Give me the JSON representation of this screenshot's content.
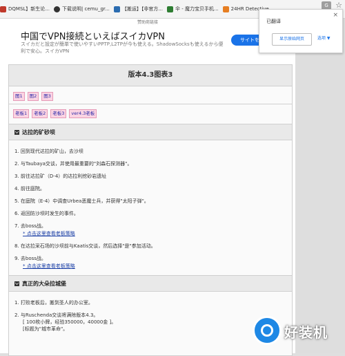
{
  "bookmarks": [
    {
      "label": "DQMSL】新生论...",
      "color": "#c0392b"
    },
    {
      "label": "下载说明| cemu_gr...",
      "color": "#333333"
    },
    {
      "label": "【搬运】【非官方...",
      "color": "#2b6cb0"
    },
    {
      "label": "伞 - 魔力宝贝手机...",
      "color": "#2e7d32"
    },
    {
      "label": "24HR Detective",
      "color": "#e67e22"
    }
  ],
  "translate_popup": {
    "title": "已翻译",
    "show_original": "显示原始网页",
    "options": "选项 ▼",
    "close": "×"
  },
  "ad": {
    "small_label": "赞助商链接",
    "title": "中国でVPN接続といえばスイカVPN",
    "desc": "スイカだと設定が簡単で使いやすいPPTP,L2TPが今も使える。ShadowSocksも使えるから便利で安心。スイカVPN",
    "button": "サイトを見る"
  },
  "article": {
    "title": "版本4.3图表3",
    "tags_row1": [
      "图1",
      "图2",
      "图3"
    ],
    "tags_row2": [
      "老板1",
      "老板2",
      "老板3",
      "ver4.3老板"
    ],
    "sections": [
      {
        "heading": "达拉的矿砂坝",
        "steps": [
          {
            "text": "1. 回到现代达拉的矿山，去沙坝"
          },
          {
            "text": "2. 与Taubaya交谈，并使用最重要的\"刘森石探测器\"。"
          },
          {
            "text": "3. 前往达拉矿（D-4）的达拉利挖砂岩遗址"
          },
          {
            "text": "4. 前往庭院。"
          },
          {
            "text": "5. 在庭院（E-4）中调查Urbea恶魔士兵，并获得\"太阳子弹\"。"
          },
          {
            "text": "6. 返回防沙坝时发生的事件。"
          },
          {
            "text": "7. 去boss战。",
            "sub": "* 点击这里查看老板策略"
          },
          {
            "text": "8. 在达拉采石场的沙坝前与Kaatis交谈，然后选择\"是\"参加活动。"
          },
          {
            "text": "9. 去boss战。",
            "sub": "* 点击这里查看老板策略"
          }
        ]
      },
      {
        "heading": "真正的大朵拉城堡",
        "steps": [
          {
            "text": "1. 打败老板后，搬到圣人的办公室。"
          },
          {
            "text": "2. 与Ruschenda交谈将满除版本4.3。",
            "bracket1": "[ 100枚小牌，经验350000，40000金 ]。",
            "bracket2": "[标题为\"城市革命\"。"
          }
        ]
      }
    ]
  },
  "watermark": {
    "text": "好装机"
  }
}
